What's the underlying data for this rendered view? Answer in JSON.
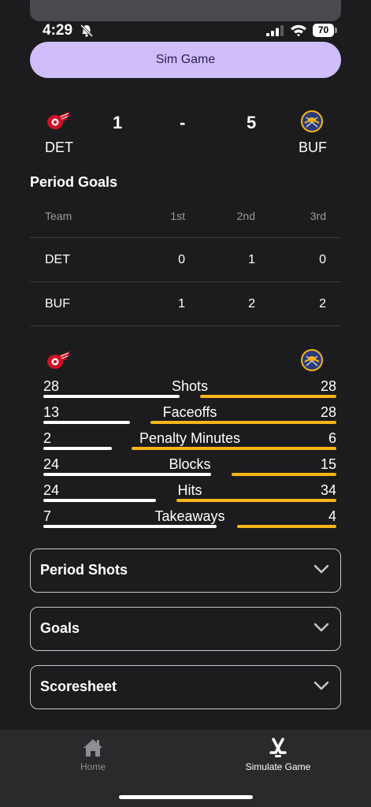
{
  "status_bar": {
    "time": "4:29",
    "battery": "70"
  },
  "actions": {
    "sim_game": "Sim Game"
  },
  "matchup": {
    "away": {
      "abbr": "DET",
      "score": "1"
    },
    "separator": "-",
    "home": {
      "abbr": "BUF",
      "score": "5"
    }
  },
  "period_goals": {
    "title": "Period Goals",
    "headers": [
      "Team",
      "1st",
      "2nd",
      "3rd"
    ],
    "rows": [
      [
        "DET",
        "0",
        "1",
        "0"
      ],
      [
        "BUF",
        "1",
        "2",
        "2"
      ]
    ]
  },
  "stats": [
    {
      "label": "Shots",
      "left": "28",
      "right": "28"
    },
    {
      "label": "Faceoffs",
      "left": "13",
      "right": "28"
    },
    {
      "label": "Penalty Minutes",
      "left": "2",
      "right": "6"
    },
    {
      "label": "Blocks",
      "left": "24",
      "right": "15"
    },
    {
      "label": "Hits",
      "left": "24",
      "right": "34"
    },
    {
      "label": "Takeaways",
      "left": "7",
      "right": "4"
    }
  ],
  "sections": [
    "Period Shots",
    "Goals",
    "Scoresheet"
  ],
  "tabs": [
    {
      "label": "Home",
      "icon": "home-icon",
      "active": false
    },
    {
      "label": "Simulate Game",
      "icon": "hockey-sticks-icon",
      "active": true
    }
  ],
  "colors": {
    "accent": "#cfbefa",
    "home_bar": "#f6b619",
    "away_bar": "#ffffff",
    "tab_inactive": "#8e8e93"
  }
}
